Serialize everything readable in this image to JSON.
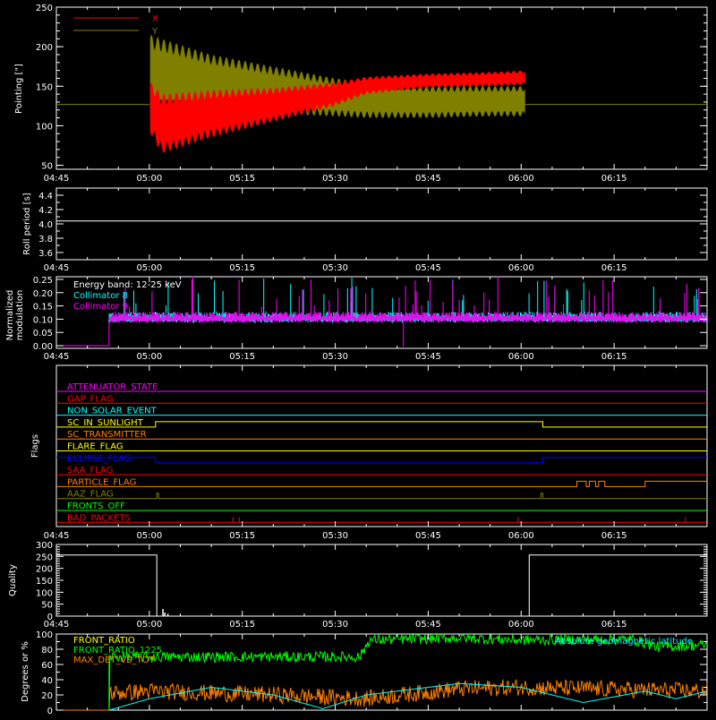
{
  "x_axis": {
    "tick_labels": [
      "04:45",
      "05:00",
      "05:15",
      "05:30",
      "05:45",
      "06:00",
      "06:15"
    ],
    "range_minutes": [
      285,
      390
    ]
  },
  "colors": {
    "background": "#000000",
    "axes": "#ffffff",
    "red": "#ff0000",
    "olive": "#808000",
    "cyan": "#00ffff",
    "magenta": "#ff00ff",
    "green": "#00ff00",
    "orange": "#ff8000",
    "blue": "#0000ff",
    "yellow": "#ffff00"
  },
  "chart_data": [
    {
      "id": "pointing",
      "type": "line",
      "ylabel": "Pointing [\"]",
      "ylim": [
        45,
        250
      ],
      "y_ticks": [
        50,
        100,
        150,
        200,
        250
      ],
      "legend": [
        "X",
        "Y"
      ],
      "legend_placement": "top-left",
      "series": [
        {
          "name": "X",
          "color": "#ff0000",
          "x": [
            285,
            300,
            300.2,
            302,
            310,
            320,
            330,
            335,
            345,
            355,
            360.6
          ],
          "lo": [
            127,
            127,
            90,
            65,
            85,
            105,
            125,
            140,
            148,
            150,
            152
          ],
          "hi": [
            127,
            127,
            155,
            140,
            145,
            148,
            155,
            162,
            166,
            168,
            170
          ]
        },
        {
          "name": "Y",
          "color": "#808000",
          "x": [
            285,
            300,
            300.2,
            302,
            310,
            320,
            330,
            335,
            345,
            355,
            360.6
          ],
          "lo": [
            127,
            127,
            110,
            118,
            118,
            115,
            112,
            110,
            110,
            112,
            112
          ],
          "hi": [
            127,
            127,
            215,
            210,
            190,
            175,
            160,
            155,
            150,
            150,
            150
          ]
        }
      ],
      "baseline": 127
    },
    {
      "id": "roll_period",
      "type": "line",
      "ylabel": "Roll period [s]",
      "ylim": [
        3.5,
        4.5
      ],
      "y_ticks": [
        "3.6",
        "3.8",
        "4.0",
        "4.2",
        "4.4"
      ],
      "series": [
        {
          "name": "",
          "color": "#ffffff",
          "x": [
            285,
            390
          ],
          "y": [
            4.04,
            4.04
          ]
        }
      ]
    },
    {
      "id": "modulation",
      "type": "line",
      "ylabel": "Normalized modulation",
      "ylim": [
        -0.01,
        0.26
      ],
      "y_ticks": [
        "0.00",
        "0.05",
        "0.10",
        "0.15",
        "0.20",
        "0.25"
      ],
      "annotations": [
        "Energy band: 12-25 keV",
        "Collimator 8",
        "Collimator 9"
      ],
      "series": [
        {
          "name": "Collimator 8",
          "color": "#00ffff",
          "start": 293.5,
          "level": 0.1
        },
        {
          "name": "Collimator 9",
          "color": "#ff00ff",
          "start": 293.5,
          "level": 0.1
        }
      ]
    },
    {
      "id": "flags",
      "type": "line",
      "ylabel": "Flags",
      "flags": [
        {
          "name": "ATTENUATOR_STATE",
          "color": "#ff00ff",
          "segments": [
            [
              285,
              0
            ],
            [
              390,
              0
            ]
          ]
        },
        {
          "name": "GAP_FLAG",
          "color": "#ff0000",
          "segments": [
            [
              285,
              0
            ],
            [
              390,
              0
            ]
          ]
        },
        {
          "name": "NON_SOLAR_EVENT",
          "color": "#00ffff",
          "segments": [
            [
              285,
              0
            ],
            [
              390,
              0
            ]
          ]
        },
        {
          "name": "SC_IN_SUNLIGHT",
          "color": "#ffff00",
          "segments": [
            [
              285,
              0
            ],
            [
              301,
              0
            ],
            [
              301,
              1
            ],
            [
              363.5,
              1
            ],
            [
              363.5,
              0
            ],
            [
              390,
              0
            ]
          ]
        },
        {
          "name": "SC_TRANSMITTER",
          "color": "#ff8000",
          "segments": [
            [
              285,
              0
            ],
            [
              390,
              0
            ]
          ]
        },
        {
          "name": "FLARE_FLAG",
          "color": "#ffff00",
          "segments": [
            [
              285,
              0
            ],
            [
              390,
              0
            ]
          ]
        },
        {
          "name": "ECLIPSE_FLAG",
          "color": "#0000ff",
          "segments": [
            [
              285,
              1
            ],
            [
              301,
              1
            ],
            [
              301,
              0
            ],
            [
              363.5,
              0
            ],
            [
              363.5,
              1
            ],
            [
              390,
              1
            ]
          ]
        },
        {
          "name": "SAA_FLAG",
          "color": "#ff0000",
          "segments": [
            [
              285,
              0
            ],
            [
              390,
              0
            ]
          ]
        },
        {
          "name": "PARTICLE_FLAG",
          "color": "#ff8000",
          "segments": [
            [
              285,
              0
            ],
            [
              369,
              0
            ],
            [
              369,
              1
            ],
            [
              370.5,
              1
            ],
            [
              370.5,
              0
            ],
            [
              371,
              0
            ],
            [
              371,
              1
            ],
            [
              372,
              1
            ],
            [
              372,
              0
            ],
            [
              372.5,
              0
            ],
            [
              372.5,
              1
            ],
            [
              373.5,
              1
            ],
            [
              373.5,
              0
            ],
            [
              380,
              0
            ],
            [
              380,
              1
            ],
            [
              390,
              1
            ]
          ]
        },
        {
          "name": "AAZ_FLAG",
          "color": "#808000",
          "segments": [
            [
              285,
              0
            ],
            [
              301.2,
              0
            ],
            [
              301.2,
              1
            ],
            [
              301.5,
              1
            ],
            [
              301.5,
              0
            ],
            [
              363.2,
              0
            ],
            [
              363.2,
              1
            ],
            [
              363.5,
              1
            ],
            [
              363.5,
              0
            ],
            [
              390,
              0
            ]
          ]
        },
        {
          "name": "FRONTS_OFF",
          "color": "#00ff00",
          "segments": [
            [
              285,
              0
            ],
            [
              390,
              0
            ]
          ]
        },
        {
          "name": "BAD_PACKETS",
          "color": "#ff0000",
          "segments": [
            [
              285,
              0
            ],
            [
              390,
              0
            ]
          ],
          "spikes": [
            313.5,
            314.5,
            359.5,
            386.5
          ]
        }
      ]
    },
    {
      "id": "quality",
      "type": "line",
      "ylabel": "Quality",
      "ylim": [
        0,
        300
      ],
      "y_ticks": [
        0,
        50,
        100,
        150,
        200,
        250,
        300
      ],
      "series": [
        {
          "name": "",
          "color": "#ffffff",
          "x": [
            285,
            301.2,
            301.2,
            361.3,
            361.3,
            390
          ],
          "y": [
            256,
            256,
            0,
            0,
            256,
            256
          ]
        }
      ],
      "spikes": [
        [
          302.2,
          30
        ],
        [
          302.5,
          15
        ],
        [
          303,
          10
        ]
      ]
    },
    {
      "id": "degrees",
      "type": "line",
      "ylabel": "Degrees or %",
      "ylim": [
        0,
        100
      ],
      "y_ticks": [
        0,
        20,
        40,
        60,
        80,
        100
      ],
      "legend": [
        "FRONT_RATIO",
        "FRONT_RATIO_1225",
        "MAX_DET_VS_TOT"
      ],
      "annotations": [
        "Absolute geomagnetic latitude"
      ],
      "series": [
        {
          "name": "FRONT_RATIO",
          "color": "#ffff00"
        },
        {
          "name": "FRONT_RATIO_1225",
          "color": "#00ff00",
          "x": [
            285,
            293.5,
            293.5,
            334,
            335.5,
            350,
            360,
            378,
            382,
            390
          ],
          "y": [
            0,
            0,
            70,
            70,
            92,
            95,
            92,
            93,
            83,
            86
          ]
        },
        {
          "name": "MAX_DET_VS_TOT",
          "color": "#ff8000",
          "x": [
            285,
            293.5,
            293.5,
            300,
            320,
            335,
            350,
            360,
            390
          ],
          "y": [
            0,
            0,
            22,
            25,
            20,
            15,
            28,
            30,
            25
          ]
        },
        {
          "name": "Absolute geomagnetic latitude",
          "color": "#00ffff",
          "x": [
            293.5,
            300,
            310,
            320,
            328,
            335,
            350,
            360,
            370,
            380,
            385,
            390
          ],
          "y": [
            0,
            15,
            30,
            20,
            2,
            20,
            35,
            30,
            10,
            25,
            15,
            25
          ]
        }
      ]
    }
  ]
}
